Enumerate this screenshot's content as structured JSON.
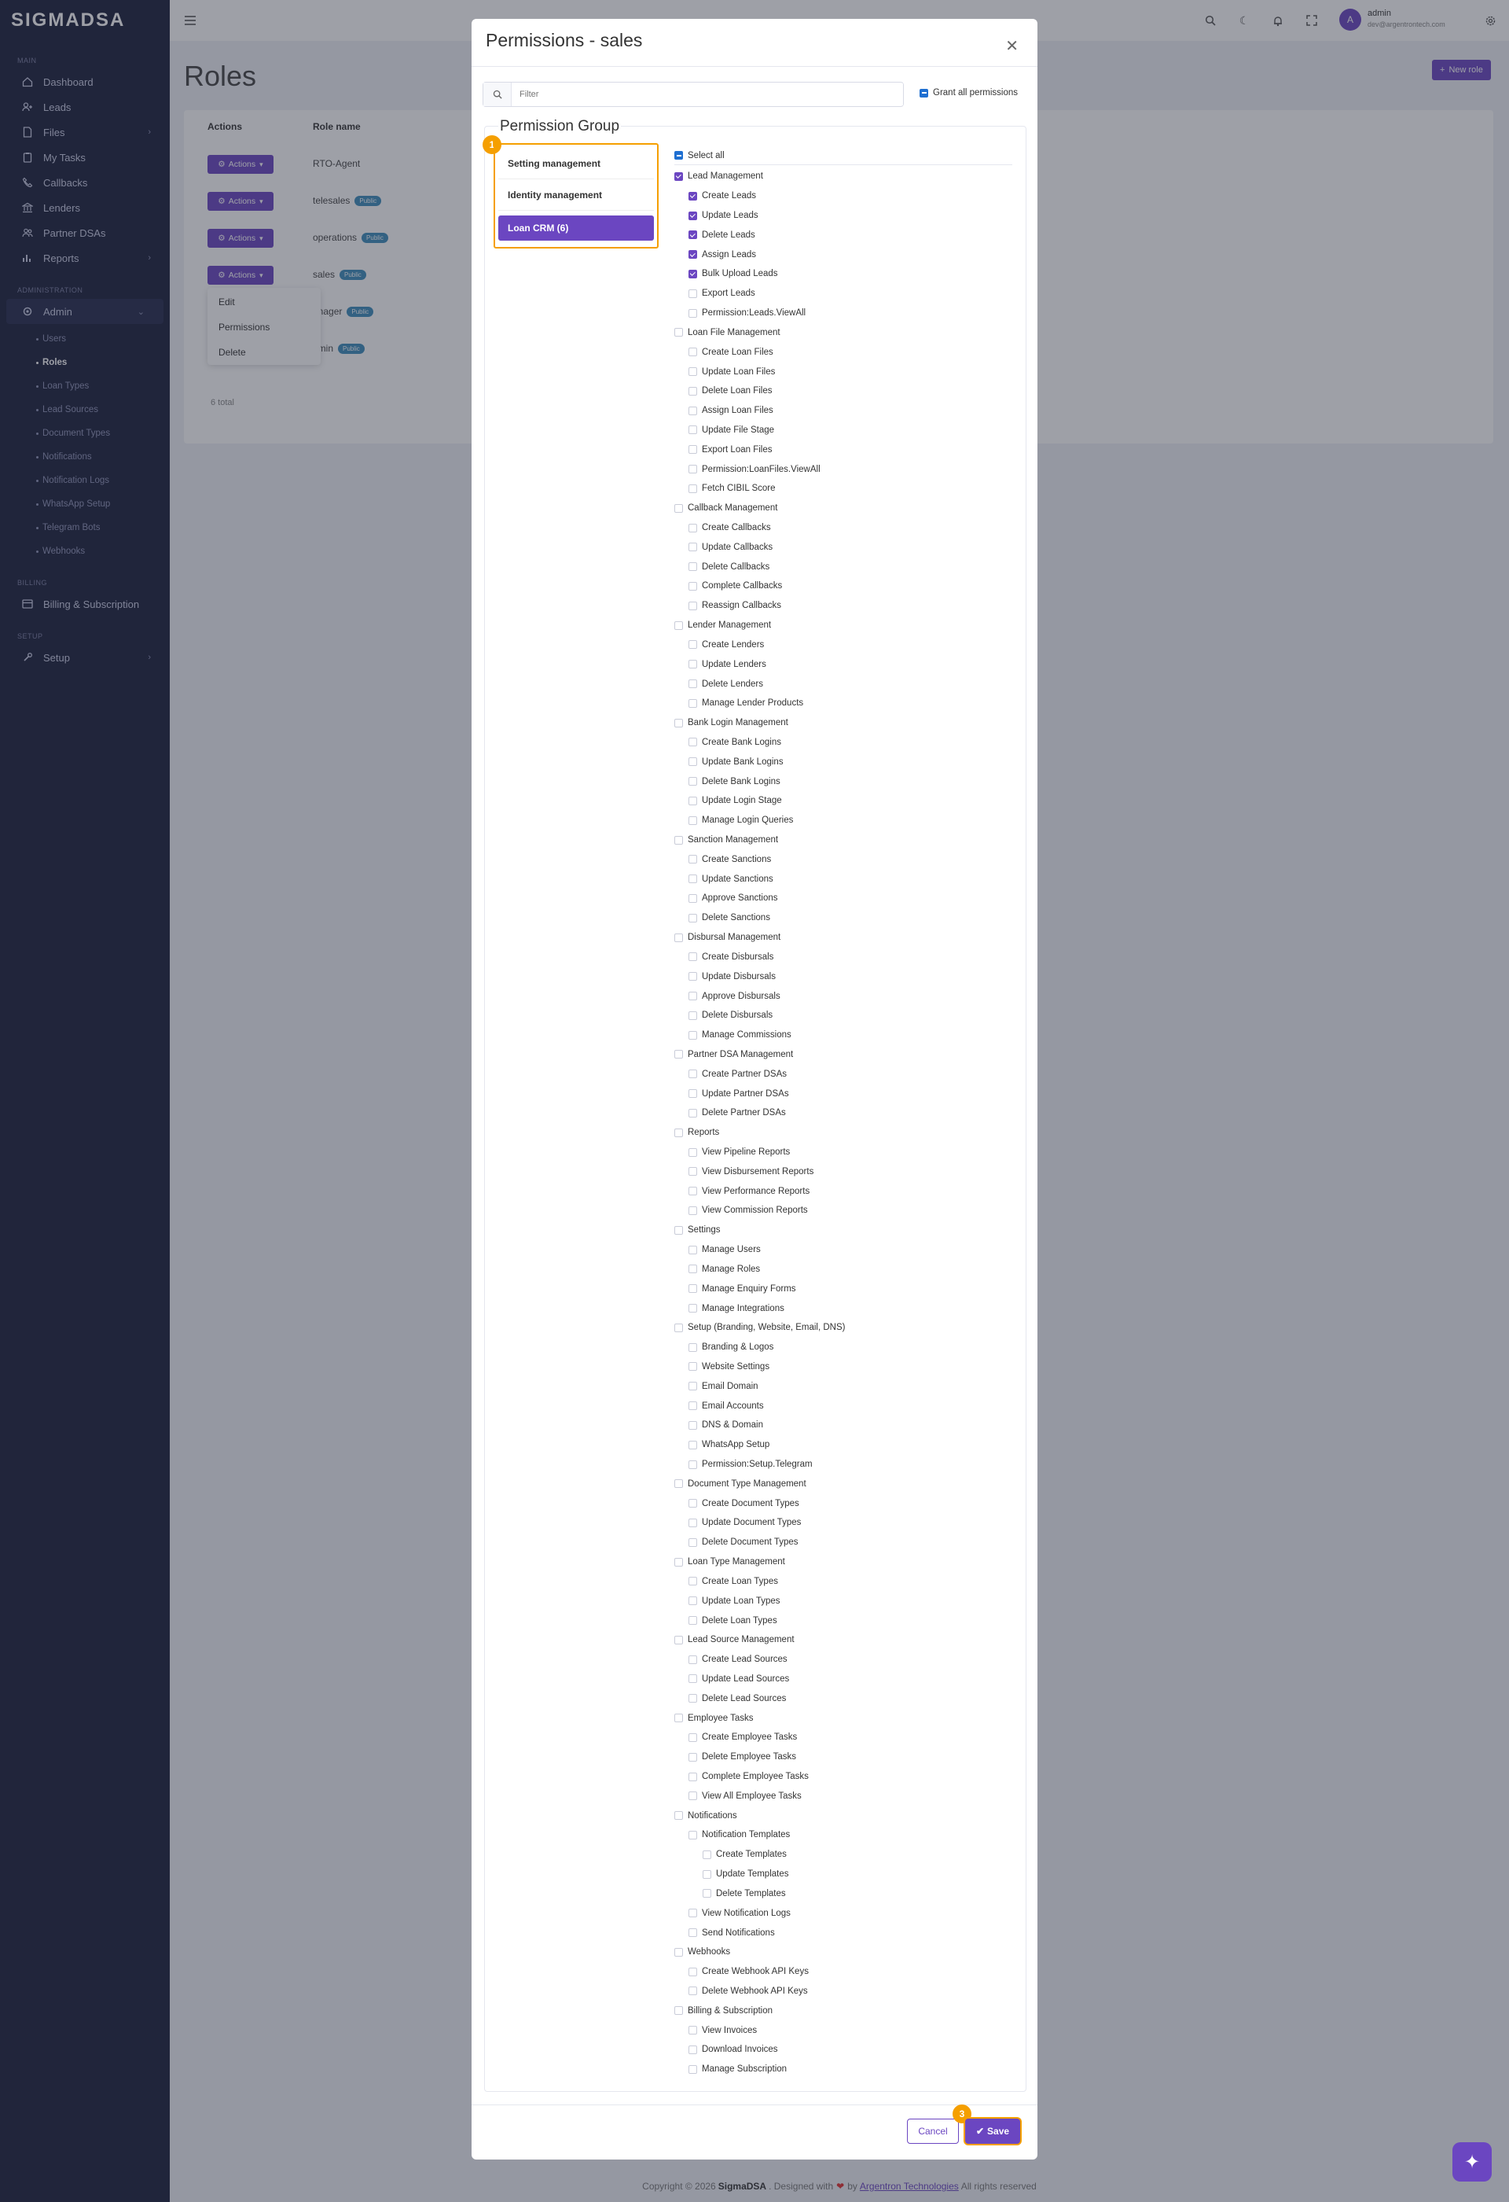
{
  "app": {
    "logo": "SIGMADSA"
  },
  "sidebar": {
    "sections": {
      "main": "MAIN",
      "administration": "ADMINISTRATION",
      "billing": "BILLING",
      "setup": "SETUP"
    },
    "main_items": [
      {
        "label": "Dashboard",
        "icon": "home-icon"
      },
      {
        "label": "Leads",
        "icon": "user-plus-icon"
      },
      {
        "label": "Files",
        "icon": "file-icon"
      },
      {
        "label": "My Tasks",
        "icon": "clipboard-icon"
      },
      {
        "label": "Callbacks",
        "icon": "phone-icon"
      },
      {
        "label": "Lenders",
        "icon": "bank-icon"
      },
      {
        "label": "Partner DSAs",
        "icon": "users-icon"
      },
      {
        "label": "Reports",
        "icon": "chart-icon"
      }
    ],
    "admin_label": "Admin",
    "admin_sub": [
      "Users",
      "Roles",
      "Loan Types",
      "Lead Sources",
      "Document Types",
      "Notifications",
      "Notification Logs",
      "WhatsApp Setup",
      "Telegram Bots",
      "Webhooks"
    ],
    "billing_item": "Billing & Subscription",
    "setup_item": "Setup"
  },
  "topbar": {
    "user_name": "admin",
    "user_email": "dev@argentrontech.com",
    "avatar_letter": "A"
  },
  "page": {
    "title": "Roles",
    "new_role": "New role",
    "col_actions": "Actions",
    "col_role": "Role name",
    "actions_label": "Actions",
    "roles": [
      {
        "name": "RTO-Agent",
        "badge": ""
      },
      {
        "name": "telesales",
        "badge": "Public"
      },
      {
        "name": "operations",
        "badge": "Public"
      },
      {
        "name": "sales",
        "badge": "Public"
      },
      {
        "name": "anager",
        "badge": "Public"
      },
      {
        "name": "dmin",
        "badge": "Public"
      }
    ],
    "dropdown": [
      "Edit",
      "Permissions",
      "Delete"
    ],
    "total": "6 total"
  },
  "modal": {
    "title": "Permissions - sales",
    "filter_placeholder": "Filter",
    "grant_all": "Grant all permissions",
    "permission_group_title": "Permission Group",
    "groups": [
      "Setting management",
      "Identity management",
      "Loan CRM (6)"
    ],
    "select_all": "Select all",
    "permissions": [
      {
        "label": "Lead Management",
        "level": 0,
        "checked": true
      },
      {
        "label": "Create Leads",
        "level": 1,
        "checked": true
      },
      {
        "label": "Update Leads",
        "level": 1,
        "checked": true
      },
      {
        "label": "Delete Leads",
        "level": 1,
        "checked": true
      },
      {
        "label": "Assign Leads",
        "level": 1,
        "checked": true
      },
      {
        "label": "Bulk Upload Leads",
        "level": 1,
        "checked": true
      },
      {
        "label": "Export Leads",
        "level": 1,
        "checked": false
      },
      {
        "label": "Permission:Leads.ViewAll",
        "level": 1,
        "checked": false
      },
      {
        "label": "Loan File Management",
        "level": 0,
        "checked": false
      },
      {
        "label": "Create Loan Files",
        "level": 1,
        "checked": false
      },
      {
        "label": "Update Loan Files",
        "level": 1,
        "checked": false
      },
      {
        "label": "Delete Loan Files",
        "level": 1,
        "checked": false
      },
      {
        "label": "Assign Loan Files",
        "level": 1,
        "checked": false
      },
      {
        "label": "Update File Stage",
        "level": 1,
        "checked": false
      },
      {
        "label": "Export Loan Files",
        "level": 1,
        "checked": false
      },
      {
        "label": "Permission:LoanFiles.ViewAll",
        "level": 1,
        "checked": false
      },
      {
        "label": "Fetch CIBIL Score",
        "level": 1,
        "checked": false
      },
      {
        "label": "Callback Management",
        "level": 0,
        "checked": false
      },
      {
        "label": "Create Callbacks",
        "level": 1,
        "checked": false
      },
      {
        "label": "Update Callbacks",
        "level": 1,
        "checked": false
      },
      {
        "label": "Delete Callbacks",
        "level": 1,
        "checked": false
      },
      {
        "label": "Complete Callbacks",
        "level": 1,
        "checked": false
      },
      {
        "label": "Reassign Callbacks",
        "level": 1,
        "checked": false
      },
      {
        "label": "Lender Management",
        "level": 0,
        "checked": false
      },
      {
        "label": "Create Lenders",
        "level": 1,
        "checked": false
      },
      {
        "label": "Update Lenders",
        "level": 1,
        "checked": false
      },
      {
        "label": "Delete Lenders",
        "level": 1,
        "checked": false
      },
      {
        "label": "Manage Lender Products",
        "level": 1,
        "checked": false
      },
      {
        "label": "Bank Login Management",
        "level": 0,
        "checked": false
      },
      {
        "label": "Create Bank Logins",
        "level": 1,
        "checked": false
      },
      {
        "label": "Update Bank Logins",
        "level": 1,
        "checked": false
      },
      {
        "label": "Delete Bank Logins",
        "level": 1,
        "checked": false
      },
      {
        "label": "Update Login Stage",
        "level": 1,
        "checked": false
      },
      {
        "label": "Manage Login Queries",
        "level": 1,
        "checked": false
      },
      {
        "label": "Sanction Management",
        "level": 0,
        "checked": false
      },
      {
        "label": "Create Sanctions",
        "level": 1,
        "checked": false
      },
      {
        "label": "Update Sanctions",
        "level": 1,
        "checked": false
      },
      {
        "label": "Approve Sanctions",
        "level": 1,
        "checked": false
      },
      {
        "label": "Delete Sanctions",
        "level": 1,
        "checked": false
      },
      {
        "label": "Disbursal Management",
        "level": 0,
        "checked": false
      },
      {
        "label": "Create Disbursals",
        "level": 1,
        "checked": false
      },
      {
        "label": "Update Disbursals",
        "level": 1,
        "checked": false
      },
      {
        "label": "Approve Disbursals",
        "level": 1,
        "checked": false
      },
      {
        "label": "Delete Disbursals",
        "level": 1,
        "checked": false
      },
      {
        "label": "Manage Commissions",
        "level": 1,
        "checked": false
      },
      {
        "label": "Partner DSA Management",
        "level": 0,
        "checked": false
      },
      {
        "label": "Create Partner DSAs",
        "level": 1,
        "checked": false
      },
      {
        "label": "Update Partner DSAs",
        "level": 1,
        "checked": false
      },
      {
        "label": "Delete Partner DSAs",
        "level": 1,
        "checked": false
      },
      {
        "label": "Reports",
        "level": 0,
        "checked": false
      },
      {
        "label": "View Pipeline Reports",
        "level": 1,
        "checked": false
      },
      {
        "label": "View Disbursement Reports",
        "level": 1,
        "checked": false
      },
      {
        "label": "View Performance Reports",
        "level": 1,
        "checked": false
      },
      {
        "label": "View Commission Reports",
        "level": 1,
        "checked": false
      },
      {
        "label": "Settings",
        "level": 0,
        "checked": false
      },
      {
        "label": "Manage Users",
        "level": 1,
        "checked": false
      },
      {
        "label": "Manage Roles",
        "level": 1,
        "checked": false
      },
      {
        "label": "Manage Enquiry Forms",
        "level": 1,
        "checked": false
      },
      {
        "label": "Manage Integrations",
        "level": 1,
        "checked": false
      },
      {
        "label": "Setup (Branding, Website, Email, DNS)",
        "level": 0,
        "checked": false
      },
      {
        "label": "Branding & Logos",
        "level": 1,
        "checked": false
      },
      {
        "label": "Website Settings",
        "level": 1,
        "checked": false
      },
      {
        "label": "Email Domain",
        "level": 1,
        "checked": false
      },
      {
        "label": "Email Accounts",
        "level": 1,
        "checked": false
      },
      {
        "label": "DNS & Domain",
        "level": 1,
        "checked": false
      },
      {
        "label": "WhatsApp Setup",
        "level": 1,
        "checked": false
      },
      {
        "label": "Permission:Setup.Telegram",
        "level": 1,
        "checked": false
      },
      {
        "label": "Document Type Management",
        "level": 0,
        "checked": false
      },
      {
        "label": "Create Document Types",
        "level": 1,
        "checked": false
      },
      {
        "label": "Update Document Types",
        "level": 1,
        "checked": false
      },
      {
        "label": "Delete Document Types",
        "level": 1,
        "checked": false
      },
      {
        "label": "Loan Type Management",
        "level": 0,
        "checked": false
      },
      {
        "label": "Create Loan Types",
        "level": 1,
        "checked": false
      },
      {
        "label": "Update Loan Types",
        "level": 1,
        "checked": false
      },
      {
        "label": "Delete Loan Types",
        "level": 1,
        "checked": false
      },
      {
        "label": "Lead Source Management",
        "level": 0,
        "checked": false
      },
      {
        "label": "Create Lead Sources",
        "level": 1,
        "checked": false
      },
      {
        "label": "Update Lead Sources",
        "level": 1,
        "checked": false
      },
      {
        "label": "Delete Lead Sources",
        "level": 1,
        "checked": false
      },
      {
        "label": "Employee Tasks",
        "level": 0,
        "checked": false
      },
      {
        "label": "Create Employee Tasks",
        "level": 1,
        "checked": false
      },
      {
        "label": "Delete Employee Tasks",
        "level": 1,
        "checked": false
      },
      {
        "label": "Complete Employee Tasks",
        "level": 1,
        "checked": false
      },
      {
        "label": "View All Employee Tasks",
        "level": 1,
        "checked": false
      },
      {
        "label": "Notifications",
        "level": 0,
        "checked": false
      },
      {
        "label": "Notification Templates",
        "level": 1,
        "checked": false
      },
      {
        "label": "Create Templates",
        "level": 2,
        "checked": false
      },
      {
        "label": "Update Templates",
        "level": 2,
        "checked": false
      },
      {
        "label": "Delete Templates",
        "level": 2,
        "checked": false
      },
      {
        "label": "View Notification Logs",
        "level": 1,
        "checked": false
      },
      {
        "label": "Send Notifications",
        "level": 1,
        "checked": false
      },
      {
        "label": "Webhooks",
        "level": 0,
        "checked": false
      },
      {
        "label": "Create Webhook API Keys",
        "level": 1,
        "checked": false
      },
      {
        "label": "Delete Webhook API Keys",
        "level": 1,
        "checked": false
      },
      {
        "label": "Billing & Subscription",
        "level": 0,
        "checked": false
      },
      {
        "label": "View Invoices",
        "level": 1,
        "checked": false
      },
      {
        "label": "Download Invoices",
        "level": 1,
        "checked": false
      },
      {
        "label": "Manage Subscription",
        "level": 1,
        "checked": false
      }
    ],
    "cancel": "Cancel",
    "save": "Save",
    "step1": "1",
    "step3": "3"
  },
  "footer": {
    "copyright": "Copyright © 2026",
    "brand": "SigmaDSA",
    "designed": ". Designed with",
    "by": "by",
    "company": "Argentron Technologies",
    "rights": "All rights reserved"
  },
  "colors": {
    "accent": "#6b46c1",
    "sidebar": "#1b1f3b",
    "highlight": "#f59f00"
  }
}
